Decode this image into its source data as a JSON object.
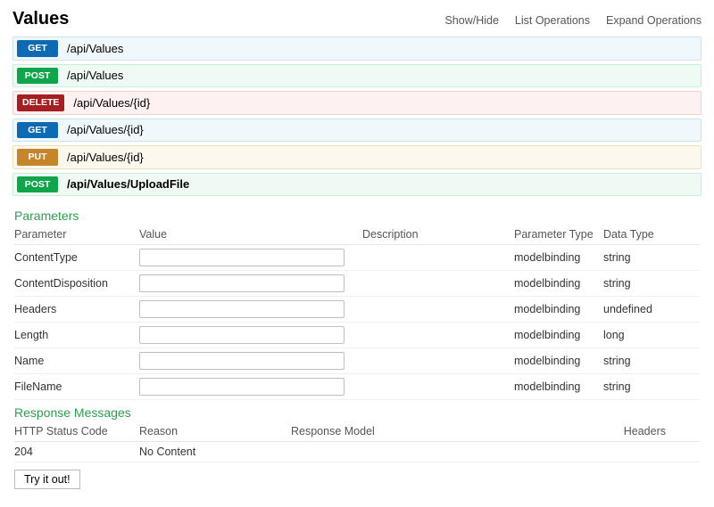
{
  "header": {
    "title": "Values",
    "links": [
      "Show/Hide",
      "List Operations",
      "Expand Operations"
    ]
  },
  "operations": [
    {
      "method": "GET",
      "path": "/api/Values"
    },
    {
      "method": "POST",
      "path": "/api/Values"
    },
    {
      "method": "DELETE",
      "path": "/api/Values/{id}"
    },
    {
      "method": "GET",
      "path": "/api/Values/{id}"
    },
    {
      "method": "PUT",
      "path": "/api/Values/{id}"
    },
    {
      "method": "POST",
      "path": "/api/Values/UploadFile",
      "expanded": true
    }
  ],
  "parameters": {
    "section_title": "Parameters",
    "headers": {
      "parameter": "Parameter",
      "value": "Value",
      "description": "Description",
      "parameter_type": "Parameter Type",
      "data_type": "Data Type"
    },
    "rows": [
      {
        "name": "ContentType",
        "value": "",
        "description": "",
        "ptype": "modelbinding",
        "dtype": "string"
      },
      {
        "name": "ContentDisposition",
        "value": "",
        "description": "",
        "ptype": "modelbinding",
        "dtype": "string"
      },
      {
        "name": "Headers",
        "value": "",
        "description": "",
        "ptype": "modelbinding",
        "dtype": "undefined"
      },
      {
        "name": "Length",
        "value": "",
        "description": "",
        "ptype": "modelbinding",
        "dtype": "long"
      },
      {
        "name": "Name",
        "value": "",
        "description": "",
        "ptype": "modelbinding",
        "dtype": "string"
      },
      {
        "name": "FileName",
        "value": "",
        "description": "",
        "ptype": "modelbinding",
        "dtype": "string"
      }
    ]
  },
  "responses": {
    "section_title": "Response Messages",
    "headers": {
      "code": "HTTP Status Code",
      "reason": "Reason",
      "model": "Response Model",
      "headers": "Headers"
    },
    "rows": [
      {
        "code": "204",
        "reason": "No Content",
        "model": "",
        "headers": ""
      }
    ]
  },
  "try_button": "Try it out!"
}
